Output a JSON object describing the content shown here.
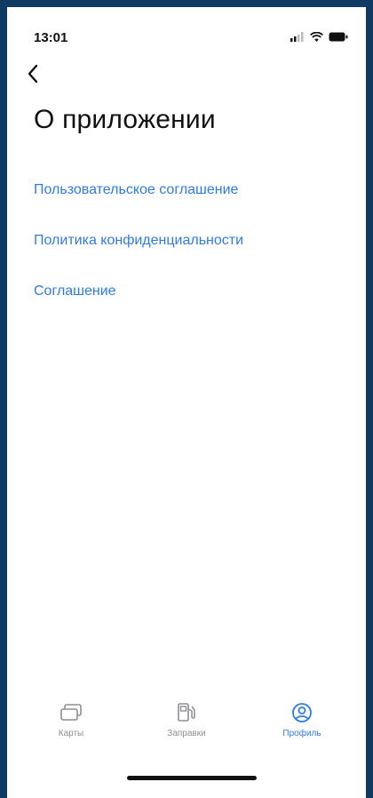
{
  "status_bar": {
    "time": "13:01",
    "icons": [
      "signal-icon",
      "wifi-icon",
      "battery-icon"
    ]
  },
  "header": {
    "back_icon": "chevron-left-icon",
    "title": "О приложении"
  },
  "links": [
    {
      "label": "Пользовательское соглашение"
    },
    {
      "label": "Политика конфиденциальности"
    },
    {
      "label": "Соглашение"
    }
  ],
  "tab_bar": {
    "tabs": [
      {
        "label": "Карты",
        "icon": "cards-icon",
        "active": false
      },
      {
        "label": "Заправки",
        "icon": "fuel-pump-icon",
        "active": false
      },
      {
        "label": "Профиль",
        "icon": "profile-icon",
        "active": true
      }
    ]
  },
  "colors": {
    "accent": "#2f7be6",
    "inactive": "#8e8e93",
    "frame": "#0f3a63"
  }
}
